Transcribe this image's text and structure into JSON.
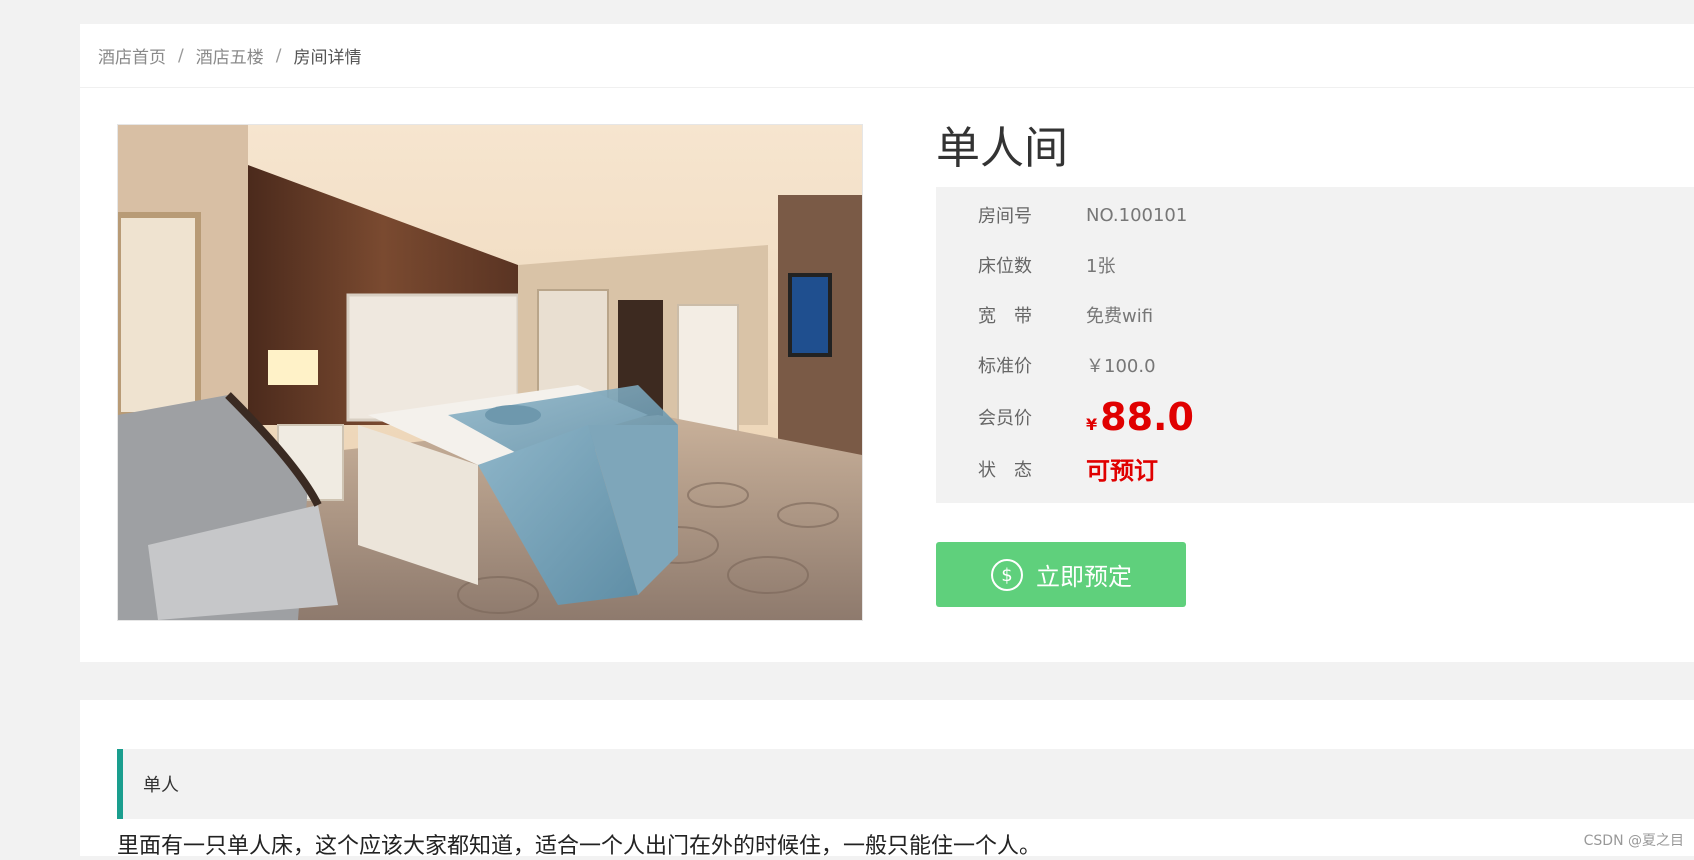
{
  "breadcrumb": {
    "items": [
      "酒店首页",
      "酒店五楼",
      "房间详情"
    ],
    "separator": "/"
  },
  "room": {
    "title": "单人间",
    "details": {
      "room_no": {
        "label": "房间号",
        "value": "NO.100101"
      },
      "beds": {
        "label": "床位数",
        "value": "1张"
      },
      "internet": {
        "label": "宽　带",
        "value": "免费wifi"
      },
      "standard_price": {
        "label": "标准价",
        "value": "￥100.0"
      },
      "member_price": {
        "label": "会员价",
        "currency": "¥",
        "value": "88.0"
      },
      "status": {
        "label": "状　态",
        "value": "可预订"
      }
    }
  },
  "actions": {
    "book_label": "立即预定",
    "book_icon": "dollar-circle-icon"
  },
  "description": {
    "heading": "单人",
    "text": "里面有一只单人床，这个应该大家都知道，适合一个人出门在外的时候住，一般只能住一个人。"
  },
  "watermark": "CSDN @夏之目",
  "colors": {
    "accent_red": "#e00000",
    "book_button": "#5fd07c",
    "desc_border": "#1a9e8e"
  }
}
